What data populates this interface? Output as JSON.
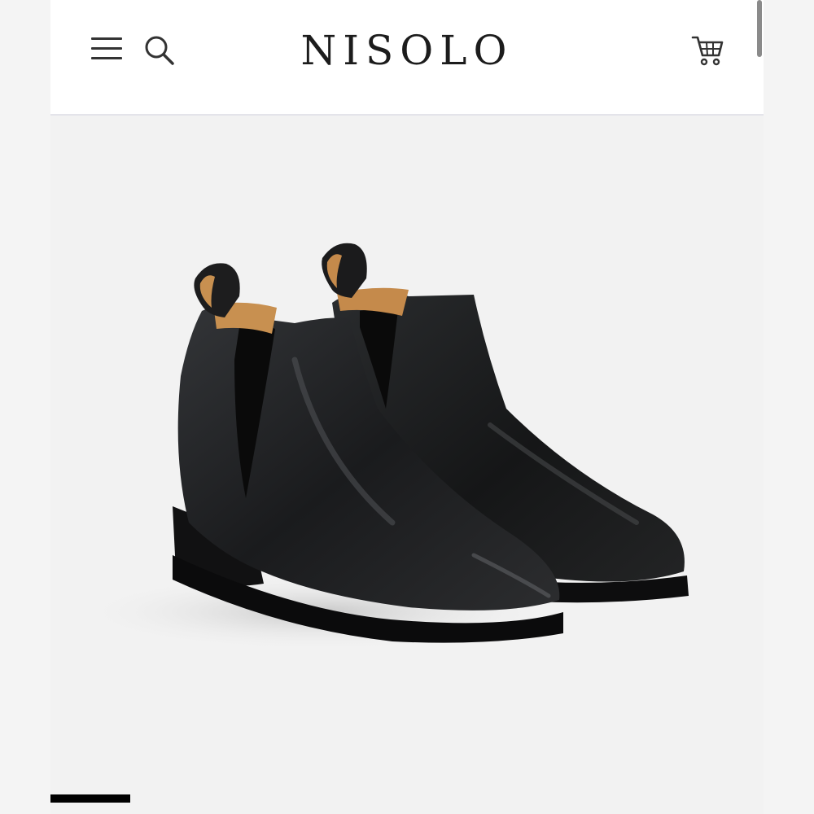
{
  "header": {
    "brand": "NISOLO",
    "icons": {
      "menu": "menu-icon",
      "search": "search-icon",
      "cart": "cart-icon"
    }
  },
  "product": {
    "image": "black-leather-chelsea-boots",
    "carousel": {
      "active_slide": 1
    }
  },
  "colors": {
    "header_bg": "#ffffff",
    "page_bg": "#f2f2f2",
    "text": "#1c1c1c",
    "indicator": "#000000"
  }
}
